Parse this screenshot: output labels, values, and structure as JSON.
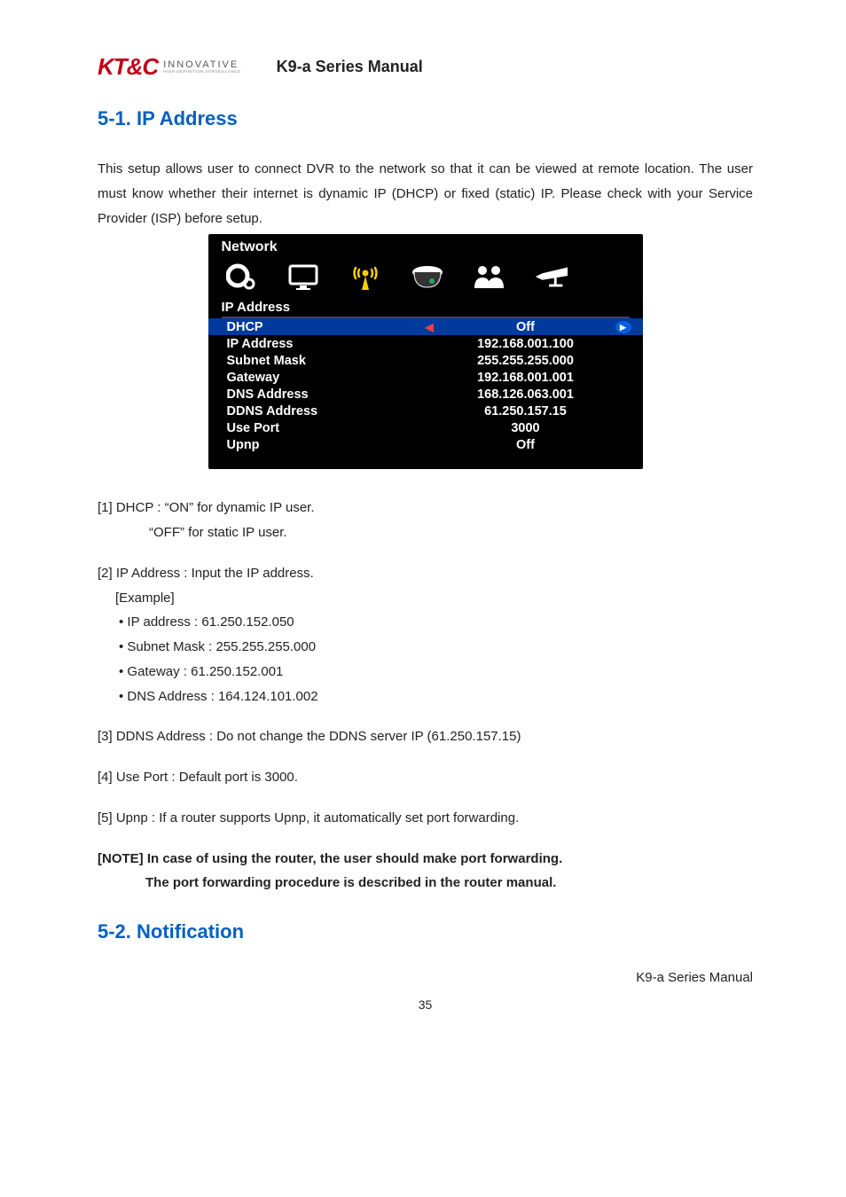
{
  "header": {
    "logo_main": "KT&C",
    "logo_sub1": "INNOVATIVE",
    "logo_sub2": "HIGH DEFINITION SURVEILLANCE",
    "doc_title": "K9-a Series Manual"
  },
  "section1": {
    "heading": "5-1. IP Address",
    "intro": "This setup allows user to connect DVR to the network so that it can be viewed at remote location. The user must know whether their internet is dynamic IP (DHCP) or fixed (static) IP. Please check with your Service Provider (ISP) before setup."
  },
  "screenshot": {
    "title": "Network",
    "subtitle": "IP Address",
    "rows": [
      {
        "label": "DHCP",
        "value": "Off",
        "highlight": true,
        "arrows": true
      },
      {
        "label": "IP Address",
        "value": "192.168.001.100"
      },
      {
        "label": "Subnet Mask",
        "value": "255.255.255.000"
      },
      {
        "label": "Gateway",
        "value": "192.168.001.001"
      },
      {
        "label": "DNS Address",
        "value": "168.126.063.001"
      },
      {
        "label": "DDNS Address",
        "value": "61.250.157.15"
      },
      {
        "label": "Use Port",
        "value": "3000"
      },
      {
        "label": "Upnp",
        "value": "Off"
      }
    ]
  },
  "notes": {
    "n1a": "[1] DHCP : “ON” for dynamic IP user.",
    "n1b": "“OFF” for static IP user.",
    "n2a": "[2] IP Address : Input the IP address.",
    "n2b": "[Example]",
    "n2c": "• IP address : 61.250.152.050",
    "n2d": "• Subnet Mask : 255.255.255.000",
    "n2e": "• Gateway : 61.250.152.001",
    "n2f": "• DNS Address : 164.124.101.002",
    "n3": "[3] DDNS Address : Do not change the DDNS server IP (61.250.157.15)",
    "n4": "[4] Use Port : Default port is 3000.",
    "n5": "[5] Upnp : If a router supports Upnp, it automatically set port forwarding.",
    "note1": "[NOTE] In case of using the router, the user should make port forwarding.",
    "note2": "The port forwarding procedure is described in the router manual."
  },
  "section2": {
    "heading": "5-2. Notification"
  },
  "footer": {
    "title": "K9-a Series Manual",
    "page": "35"
  }
}
